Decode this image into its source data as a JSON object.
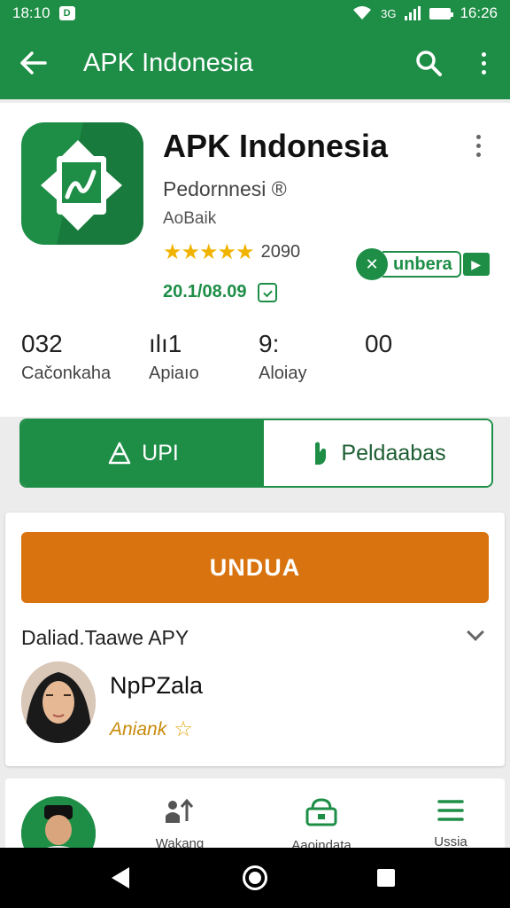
{
  "status_bar": {
    "time_left": "18:10",
    "app_icon": "D",
    "signal_text": "3G",
    "time_right": "16:26"
  },
  "toolbar": {
    "title": "APK Indonesia",
    "back_icon": "arrow-left-icon",
    "search_icon": "search-icon",
    "more_icon": "more-vert-icon"
  },
  "app": {
    "name": "APK Indonesia",
    "developer": "Pedornnesi ®",
    "category": "AoBaik",
    "stars": "★★★★★",
    "rating_count": "2090",
    "date": "20.1/08.09",
    "stats": [
      {
        "value": "032",
        "label": "Cačonkaha"
      },
      {
        "value": "ılı1",
        "label": "Apiaıo"
      },
      {
        "value": "9:",
        "label": "Aloiay"
      },
      {
        "value": "00",
        "label": ""
      }
    ],
    "uncertified_label": "unbera",
    "accent_color": "#1e8e47"
  },
  "actions": {
    "primary_label": "UPI",
    "secondary_label": "Peldaabas"
  },
  "download": {
    "button_label": "UNDUA",
    "button_color": "#d9730f",
    "note": "Daliad.Taawe APY",
    "reviewer_name": "NpPZala",
    "reviewer_badge": "Aniank"
  },
  "bottom_nav": {
    "items": [
      {
        "icon": "people-icon",
        "label": "Wakang"
      },
      {
        "icon": "bag-icon",
        "label": "Aaoindata"
      },
      {
        "icon": "menu-icon",
        "label": "Ussia"
      }
    ]
  }
}
